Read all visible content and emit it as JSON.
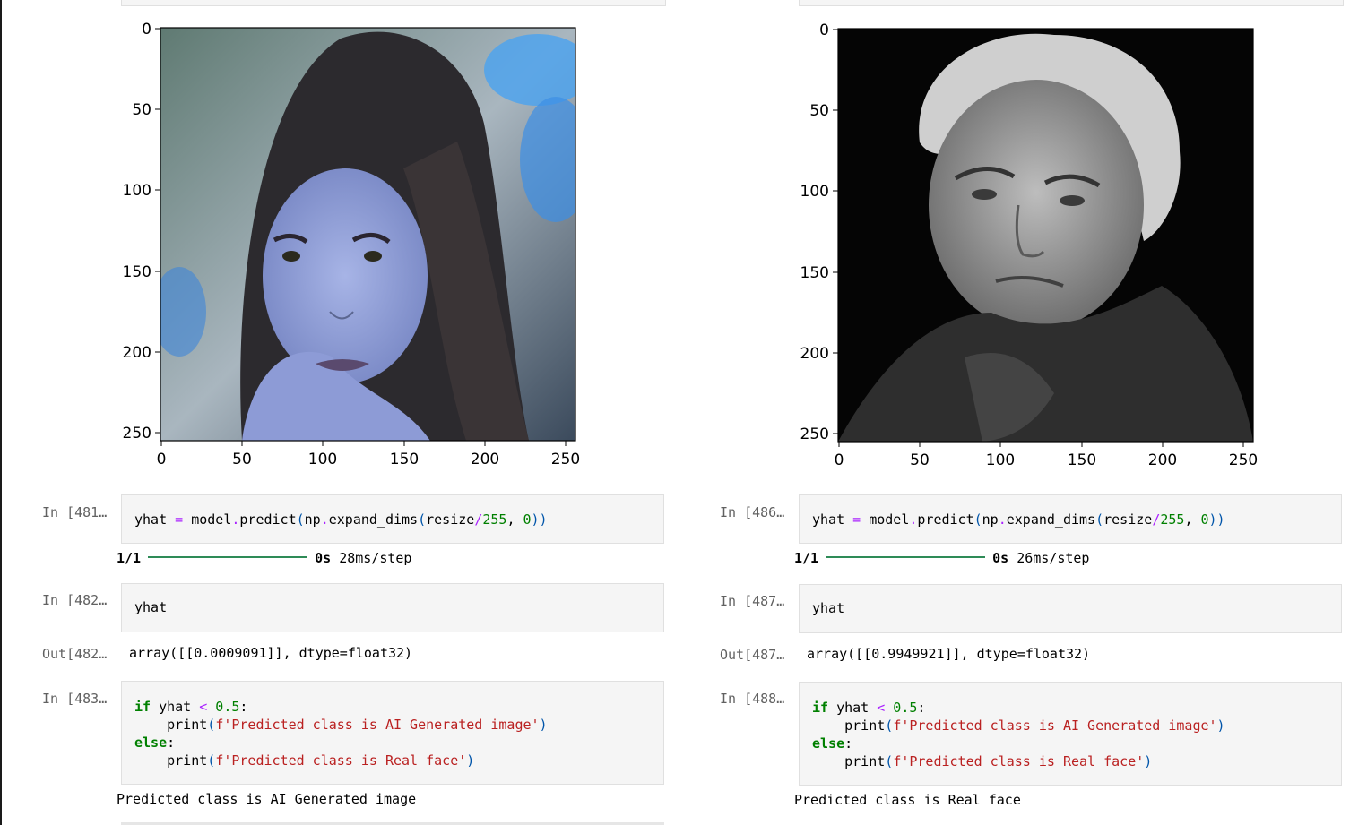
{
  "panes": [
    {
      "id": "left",
      "plot": {
        "image_desc": "woman-portrait-blue-tint",
        "x_ticks": [
          "0",
          "50",
          "100",
          "150",
          "200",
          "250"
        ],
        "y_ticks": [
          "0",
          "50",
          "100",
          "150",
          "200",
          "250"
        ]
      },
      "cell_predict": {
        "prompt": "In [481…",
        "code_parts": {
          "a": "yhat ",
          "eq": "=",
          "b": " model",
          "dot1": ".",
          "c": "predict",
          "p1": "(",
          "d": "np",
          "dot2": ".",
          "e": "expand_dims",
          "p2": "(",
          "f": "resize",
          "slash": "/",
          "n1": "255",
          "comma": ", ",
          "n2": "0",
          "p3": "))"
        },
        "progress_count": "1/1",
        "progress_time": "0s",
        "progress_step": "28ms/step"
      },
      "cell_yhat": {
        "prompt": "In [482…",
        "code": "yhat"
      },
      "out_yhat": {
        "prompt": "Out[482…",
        "value": "array([[0.0009091]], dtype=float32)"
      },
      "cell_if": {
        "prompt": "In [483…",
        "line1": {
          "kw": "if",
          "a": " yhat ",
          "op": "<",
          "num": " 0.5",
          "colon": ":"
        },
        "line2": {
          "indent": "    ",
          "fn": "print",
          "p1": "(",
          "str": "f'Predicted class is AI Generated image'",
          "p2": ")"
        },
        "line3": {
          "kw": "else",
          "colon": ":"
        },
        "line4": {
          "indent": "    ",
          "fn": "print",
          "p1": "(",
          "str": "f'Predicted class is Real face'",
          "p2": ")"
        }
      },
      "result": "Predicted class is AI Generated image"
    },
    {
      "id": "right",
      "plot": {
        "image_desc": "old-man-portrait-grayscale",
        "x_ticks": [
          "0",
          "50",
          "100",
          "150",
          "200",
          "250"
        ],
        "y_ticks": [
          "0",
          "50",
          "100",
          "150",
          "200",
          "250"
        ]
      },
      "cell_predict": {
        "prompt": "In [486…",
        "code_parts": {
          "a": "yhat ",
          "eq": "=",
          "b": " model",
          "dot1": ".",
          "c": "predict",
          "p1": "(",
          "d": "np",
          "dot2": ".",
          "e": "expand_dims",
          "p2": "(",
          "f": "resize",
          "slash": "/",
          "n1": "255",
          "comma": ", ",
          "n2": "0",
          "p3": "))"
        },
        "progress_count": "1/1",
        "progress_time": "0s",
        "progress_step": "26ms/step"
      },
      "cell_yhat": {
        "prompt": "In [487…",
        "code": "yhat"
      },
      "out_yhat": {
        "prompt": "Out[487…",
        "value": "array([[0.9949921]], dtype=float32)"
      },
      "cell_if": {
        "prompt": "In [488…",
        "line1": {
          "kw": "if",
          "a": " yhat ",
          "op": "<",
          "num": " 0.5",
          "colon": ":"
        },
        "line2": {
          "indent": "    ",
          "fn": "print",
          "p1": "(",
          "str": "f'Predicted class is AI Generated image'",
          "p2": ")"
        },
        "line3": {
          "kw": "else",
          "colon": ":"
        },
        "line4": {
          "indent": "    ",
          "fn": "print",
          "p1": "(",
          "str": "f'Predicted class is Real face'",
          "p2": ")"
        }
      },
      "result": "Predicted class is Real face"
    }
  ]
}
